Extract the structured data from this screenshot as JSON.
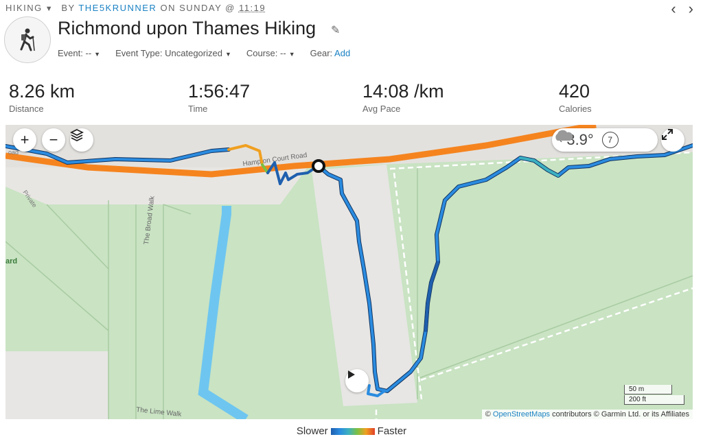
{
  "header": {
    "activity_type": "HIKING",
    "by_label": "BY",
    "author": "THE5KRUNNER",
    "on_label": "ON SUNDAY @",
    "time": "11:19",
    "prev_icon": "chevron-left-icon",
    "next_icon": "chevron-right-icon"
  },
  "activity": {
    "title": "Richmond upon Thames Hiking",
    "avatar_icon": "hiker-icon"
  },
  "meta": {
    "event_label": "Event:",
    "event_value": "--",
    "event_type_label": "Event Type:",
    "event_type_value": "Uncategorized",
    "course_label": "Course:",
    "course_value": "--",
    "gear_label": "Gear:",
    "gear_link": "Add"
  },
  "stats": [
    {
      "value": "8.26 km",
      "label": "Distance"
    },
    {
      "value": "1:56:47",
      "label": "Time"
    },
    {
      "value": "14:08 /km",
      "label": "Avg Pace"
    },
    {
      "value": "420",
      "label": "Calories"
    }
  ],
  "map": {
    "zoom_in": "+",
    "zoom_out": "−",
    "weather_temp": "3.9°",
    "wind_speed": "7",
    "weather_icon": "cloud-icon",
    "labels": {
      "road": "Hampton Court Road",
      "walk1": "The Broad Walk",
      "walk2": "The Lime Walk",
      "private": "Private",
      "road_left": "oad",
      "place": "ard"
    },
    "scale_metric": "50 m",
    "scale_imperial": "200 ft",
    "attribution_prefix": "©",
    "attribution_link": "OpenStreetMaps",
    "attribution_rest": "contributors © Garmin Ltd. or its Affiliates"
  },
  "legend": {
    "slower": "Slower",
    "faster": "Faster"
  },
  "colors": {
    "accent": "#1a82c4",
    "route": "#2b8ce0",
    "road": "#f5841f",
    "water": "#6ec6f0",
    "park": "#c9e3c3"
  }
}
